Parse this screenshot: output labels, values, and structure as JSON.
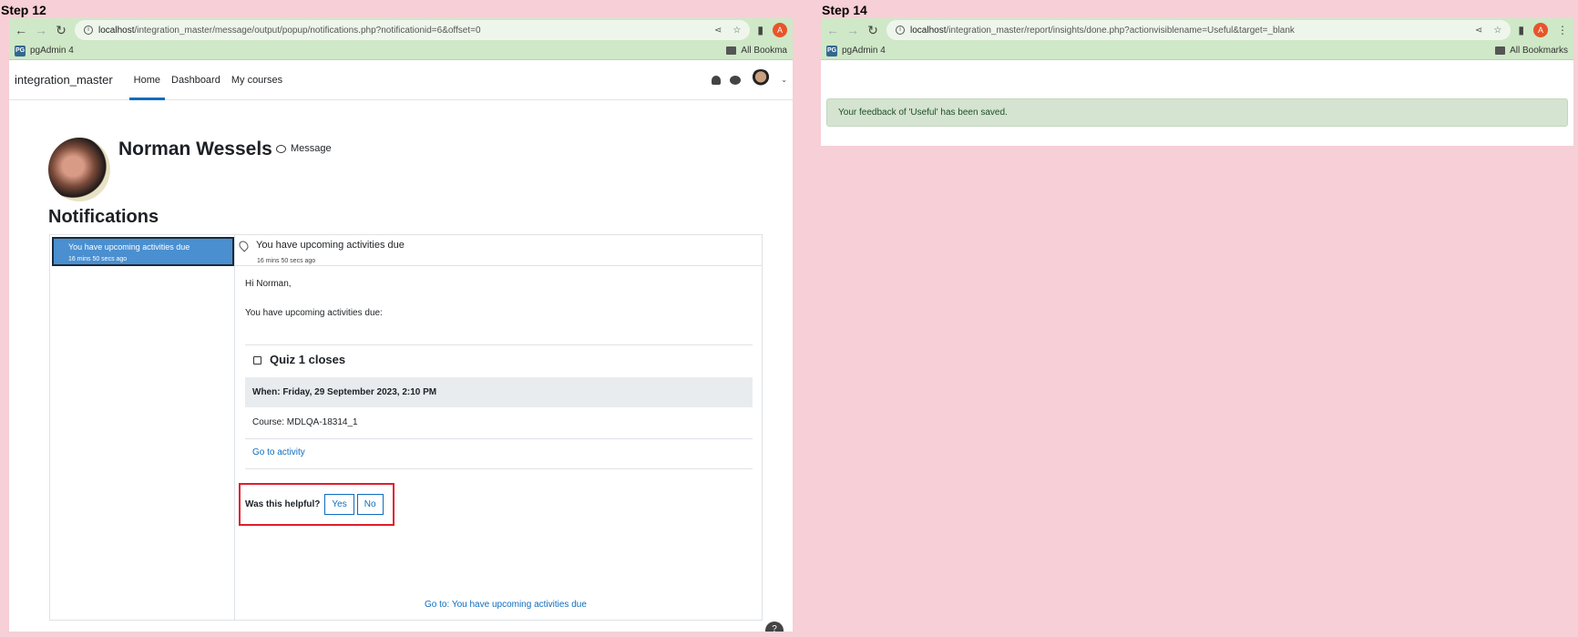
{
  "step_left": {
    "label": "Step 12",
    "url_host": "localhost",
    "url_path": "/integration_master/message/output/popup/notifications.php?notificationid=6&offset=0",
    "bookmark": "pgAdmin 4",
    "all_bookmarks": "All Bookma",
    "site_name": "integration_master",
    "nav": [
      "Home",
      "Dashboard",
      "My courses"
    ],
    "profile_name": "Norman Wessels",
    "message_label": "Message",
    "page_heading": "Notifications",
    "list_item": {
      "subject": "You have upcoming activities due",
      "time": "16 mins 50 secs ago"
    },
    "detail": {
      "subject": "You have upcoming activities due",
      "time": "16 mins 50 secs ago",
      "greeting": "Hi Norman,",
      "intro": "You have upcoming activities due:",
      "quiz_title": "Quiz 1 closes",
      "when": "When: Friday, 29 September 2023, 2:10 PM",
      "course": "Course: MDLQA-18314_1",
      "go_activity": "Go to activity",
      "helpful_label": "Was this helpful?",
      "yes": "Yes",
      "no": "No",
      "goto_link": "Go to: You have upcoming activities due"
    }
  },
  "step_right": {
    "label": "Step 14",
    "url_host": "localhost",
    "url_path": "/integration_master/report/insights/done.php?actionvisiblename=Useful&target=_blank",
    "bookmark": "pgAdmin 4",
    "all_bookmarks": "All Bookmarks",
    "alert": "Your feedback of 'Useful' has been saved."
  },
  "colors": {
    "page_bg": "#f7cfd6",
    "toolbar": "#cfe8c7",
    "accent": "#0f6cbf",
    "highlight_border": "#e01d2b",
    "success_bg": "#d4e4d0"
  }
}
